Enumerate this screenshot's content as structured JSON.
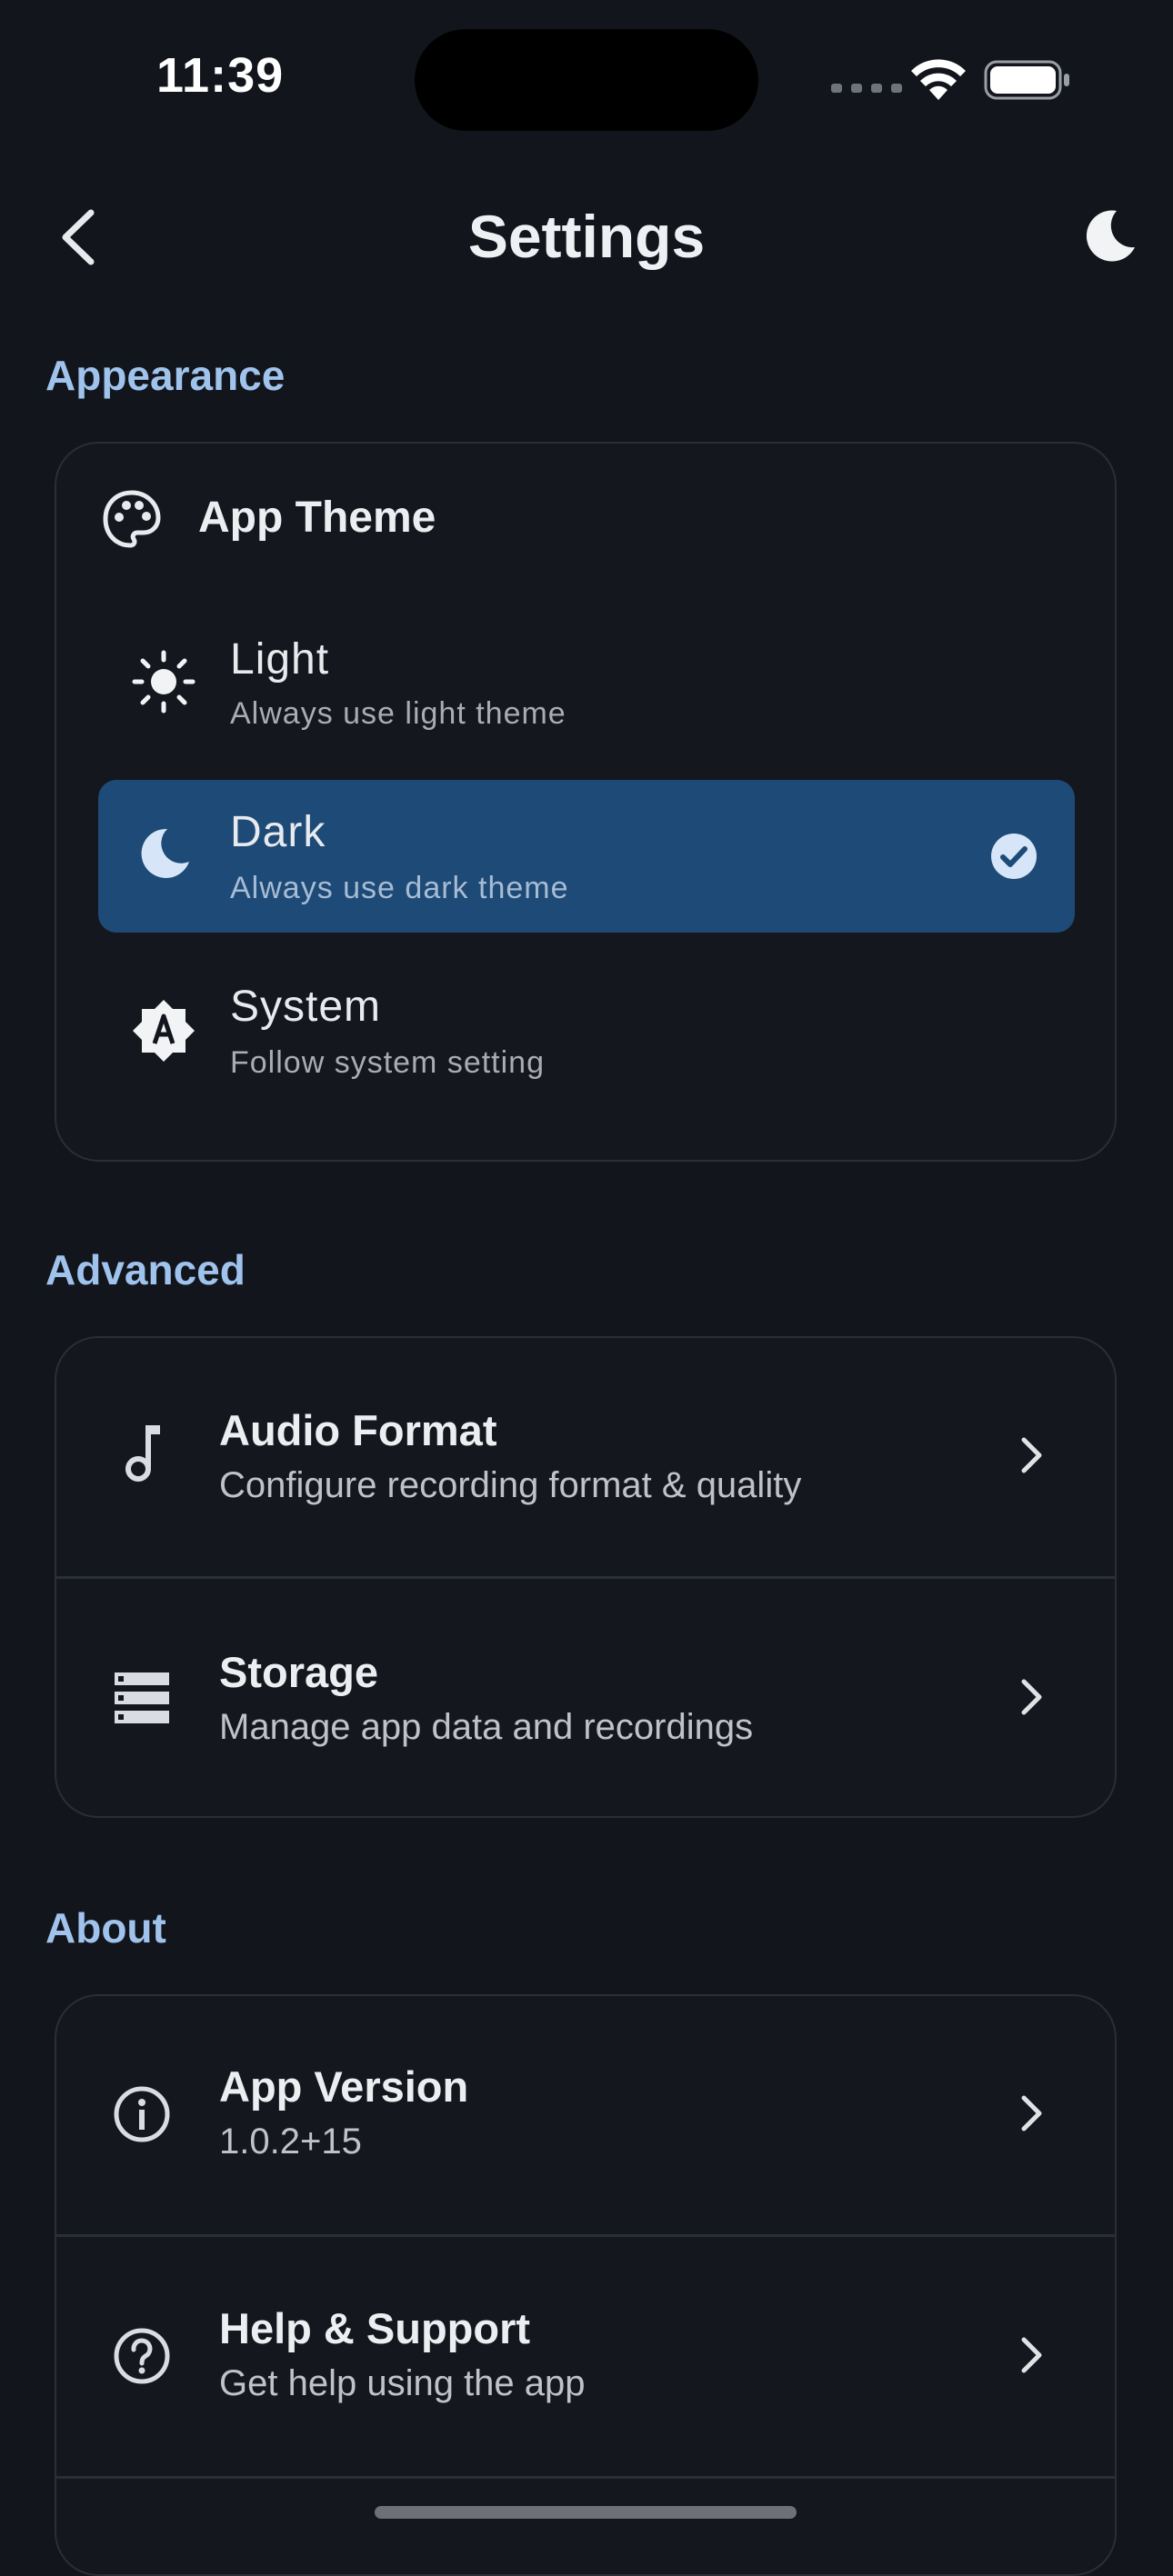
{
  "status_bar": {
    "time": "11:39"
  },
  "header": {
    "title": "Settings"
  },
  "sections": {
    "appearance": "Appearance",
    "advanced": "Advanced",
    "about": "About"
  },
  "app_theme": {
    "label": "App Theme",
    "options": [
      {
        "title": "Light",
        "subtitle": "Always use light theme",
        "selected": false
      },
      {
        "title": "Dark",
        "subtitle": "Always use dark theme",
        "selected": true
      },
      {
        "title": "System",
        "subtitle": "Follow system setting",
        "selected": false
      }
    ]
  },
  "advanced_items": [
    {
      "title": "Audio Format",
      "subtitle": "Configure recording format & quality",
      "icon": "music-note-icon"
    },
    {
      "title": "Storage",
      "subtitle": "Manage app data and recordings",
      "icon": "storage-icon"
    }
  ],
  "about_items": [
    {
      "title": "App Version",
      "subtitle": "1.0.2+15",
      "icon": "info-icon"
    },
    {
      "title": "Help & Support",
      "subtitle": "Get help using the app",
      "icon": "help-icon"
    }
  ],
  "colors": {
    "background": "#12151b",
    "accent": "#9fc3ec",
    "selected": "#1d4a77"
  }
}
